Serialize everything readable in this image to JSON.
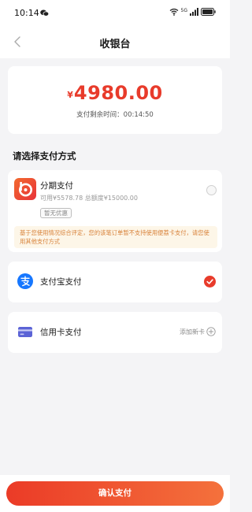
{
  "status_bar": {
    "time": "10:14",
    "network": "5G"
  },
  "header": {
    "title": "收银台"
  },
  "amount": {
    "currency": "¥",
    "value": "4980.00",
    "countdown_label": "支付剩余时间：00:14:50"
  },
  "section_title": "请选择支付方式",
  "installment": {
    "title": "分期支付",
    "subtitle": "可用¥5578.78 总额度¥15000.00",
    "tag": "暂无优惠",
    "notice": "基于您使用情况综合评定，您的该笔订单暂不支持使用便荔卡支付，请您使用其他支付方式",
    "selected": false
  },
  "alipay": {
    "label": "支付宝支付",
    "selected": true
  },
  "credit_card": {
    "label": "信用卡支付",
    "add_label": "添加新卡"
  },
  "confirm_button": "确认支付",
  "colors": {
    "accent": "#e83b2b",
    "alipay_blue": "#1677ff",
    "card_purple": "#5b63d6",
    "notice_bg": "#fdf6e8",
    "notice_text": "#d8823a"
  },
  "icons": {
    "chat": "wechat-icon",
    "wifi": "wifi-icon",
    "signal": "signal-icon",
    "battery": "battery-icon",
    "back": "back-arrow-icon",
    "installment": "installment-logo-icon",
    "alipay": "alipay-icon",
    "credit_card": "credit-card-icon",
    "add": "add-circle-icon",
    "check": "check-icon"
  }
}
